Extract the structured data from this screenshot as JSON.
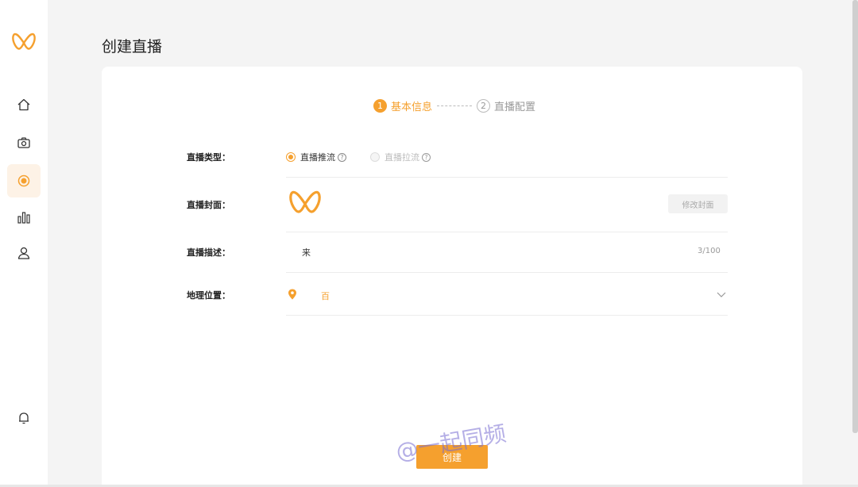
{
  "page": {
    "title": "创建直播"
  },
  "sidebar": {
    "logo": "brand-logo",
    "items": [
      {
        "icon": "home-icon",
        "active": false
      },
      {
        "icon": "camera-icon",
        "active": false
      },
      {
        "icon": "live-record-icon",
        "active": true
      },
      {
        "icon": "bar-chart-icon",
        "active": false
      },
      {
        "icon": "user-icon",
        "active": false
      }
    ],
    "bottom_icon": "bell-icon"
  },
  "steps": [
    {
      "number": "1",
      "label": "基本信息",
      "active": true
    },
    {
      "number": "2",
      "label": "直播配置",
      "active": false
    }
  ],
  "form": {
    "type": {
      "label": "直播类型：",
      "options": [
        {
          "label": "直播推流",
          "checked": true,
          "disabled": false
        },
        {
          "label": "直播拉流",
          "checked": false,
          "disabled": true
        }
      ],
      "help_glyph": "?"
    },
    "cover": {
      "label": "直播封面：",
      "button": "修改封面"
    },
    "description": {
      "label": "直播描述：",
      "value": "来",
      "count": "3/100"
    },
    "location": {
      "label": "地理位置：",
      "value": "百"
    }
  },
  "actions": {
    "create": "创建"
  },
  "watermark": "@一起同频",
  "colors": {
    "accent": "#f5a02e",
    "active_bg": "#fdf2e6",
    "background": "#f4f4f4"
  }
}
